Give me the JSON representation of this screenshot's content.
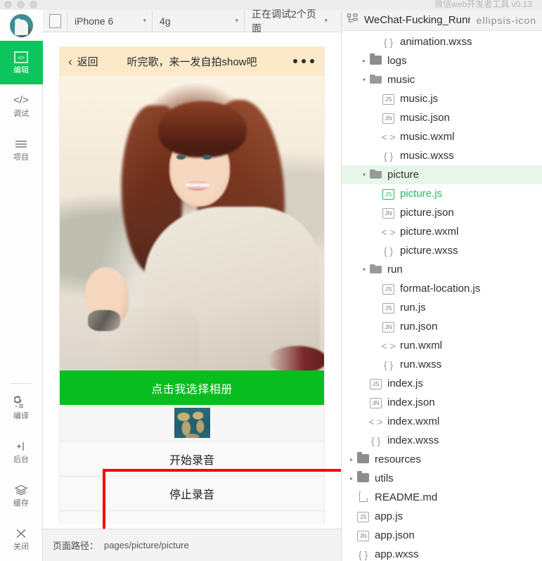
{
  "window": {
    "app_title": "微信web开发者工具 v0.13",
    "traffic_lights": [
      "close",
      "minimize",
      "maximize"
    ]
  },
  "sidebar": {
    "avatar_name": "user-avatar",
    "items": [
      {
        "label": "编辑",
        "icon": "code-brackets-icon",
        "active": true
      },
      {
        "label": "调试",
        "icon": "angle-brackets-icon",
        "active": false
      },
      {
        "label": "项目",
        "icon": "lines-icon",
        "active": false
      },
      {
        "label": "编译",
        "icon": "refresh-build-icon",
        "active": false
      },
      {
        "label": "后台",
        "icon": "background-icon",
        "active": false
      },
      {
        "label": "缓存",
        "icon": "layers-icon",
        "active": false
      },
      {
        "label": "关闭",
        "icon": "close-x-icon",
        "active": false
      }
    ]
  },
  "simulator_toolbar": {
    "rotate_button": "rotate-device",
    "device": "iPhone 6",
    "network": "4g",
    "debug_status": "正在调试2个页面",
    "caret": "▾"
  },
  "phone": {
    "nav": {
      "back_label": "返回",
      "back_chevron": "‹",
      "title": "听完歌，来一发自拍show吧",
      "more_icon": "ellipsis-icon"
    },
    "photo_alt": "girl-portrait-photo",
    "choose_album_button": "点击我选择相册",
    "thumbnail_alt": "world-map-thumbnail",
    "start_record_button": "开始录音",
    "stop_record_button": "停止录音"
  },
  "annotation": {
    "color": "#fb0007",
    "name": "red-highlight-box"
  },
  "pathbar": {
    "label": "页面路径：",
    "value": "pages/picture/picture"
  },
  "tree": {
    "project_title": "WeChat-Fucking_Running",
    "more_icon": "ellipsis-icon",
    "rows": [
      {
        "name": "animation.wxss",
        "type": "wxss",
        "indent": 2,
        "arrow": "",
        "selected": false,
        "green": false
      },
      {
        "name": "logs",
        "type": "folder",
        "indent": 1,
        "arrow": "▸",
        "selected": false,
        "green": false
      },
      {
        "name": "music",
        "type": "folder-open",
        "indent": 1,
        "arrow": "▾",
        "selected": false,
        "green": false
      },
      {
        "name": "music.js",
        "type": "js",
        "indent": 2,
        "arrow": "",
        "selected": false,
        "green": false
      },
      {
        "name": "music.json",
        "type": "json",
        "indent": 2,
        "arrow": "",
        "selected": false,
        "green": false
      },
      {
        "name": "music.wxml",
        "type": "wxml",
        "indent": 2,
        "arrow": "",
        "selected": false,
        "green": false
      },
      {
        "name": "music.wxss",
        "type": "wxss",
        "indent": 2,
        "arrow": "",
        "selected": false,
        "green": false
      },
      {
        "name": "picture",
        "type": "folder-open",
        "indent": 1,
        "arrow": "▾",
        "selected": true,
        "green": false
      },
      {
        "name": "picture.js",
        "type": "js-green",
        "indent": 2,
        "arrow": "",
        "selected": false,
        "green": true
      },
      {
        "name": "picture.json",
        "type": "json",
        "indent": 2,
        "arrow": "",
        "selected": false,
        "green": false
      },
      {
        "name": "picture.wxml",
        "type": "wxml",
        "indent": 2,
        "arrow": "",
        "selected": false,
        "green": false
      },
      {
        "name": "picture.wxss",
        "type": "wxss",
        "indent": 2,
        "arrow": "",
        "selected": false,
        "green": false
      },
      {
        "name": "run",
        "type": "folder-open",
        "indent": 1,
        "arrow": "▾",
        "selected": false,
        "green": false
      },
      {
        "name": "format-location.js",
        "type": "js",
        "indent": 2,
        "arrow": "",
        "selected": false,
        "green": false
      },
      {
        "name": "run.js",
        "type": "js",
        "indent": 2,
        "arrow": "",
        "selected": false,
        "green": false
      },
      {
        "name": "run.json",
        "type": "json",
        "indent": 2,
        "arrow": "",
        "selected": false,
        "green": false
      },
      {
        "name": "run.wxml",
        "type": "wxml",
        "indent": 2,
        "arrow": "",
        "selected": false,
        "green": false
      },
      {
        "name": "run.wxss",
        "type": "wxss",
        "indent": 2,
        "arrow": "",
        "selected": false,
        "green": false
      },
      {
        "name": "index.js",
        "type": "js",
        "indent": 1,
        "arrow": "",
        "selected": false,
        "green": false
      },
      {
        "name": "index.json",
        "type": "json",
        "indent": 1,
        "arrow": "",
        "selected": false,
        "green": false
      },
      {
        "name": "index.wxml",
        "type": "wxml",
        "indent": 1,
        "arrow": "",
        "selected": false,
        "green": false
      },
      {
        "name": "index.wxss",
        "type": "wxss",
        "indent": 1,
        "arrow": "",
        "selected": false,
        "green": false
      },
      {
        "name": "resources",
        "type": "folder",
        "indent": 0,
        "arrow": "▸",
        "selected": false,
        "green": false
      },
      {
        "name": "utils",
        "type": "folder",
        "indent": 0,
        "arrow": "▸",
        "selected": false,
        "green": false
      },
      {
        "name": "README.md",
        "type": "md",
        "indent": 0,
        "arrow": "",
        "selected": false,
        "green": false
      },
      {
        "name": "app.js",
        "type": "js",
        "indent": 0,
        "arrow": "",
        "selected": false,
        "green": false
      },
      {
        "name": "app.json",
        "type": "json",
        "indent": 0,
        "arrow": "",
        "selected": false,
        "green": false
      },
      {
        "name": "app.wxss",
        "type": "wxss",
        "indent": 0,
        "arrow": "",
        "selected": false,
        "green": false
      }
    ]
  },
  "colors": {
    "accent_green": "#0ec45c",
    "button_green": "#07bd1f",
    "nav_cream": "#fbe9c8",
    "annotation_red": "#fb0007",
    "tree_selection": "#e6f7ea"
  }
}
